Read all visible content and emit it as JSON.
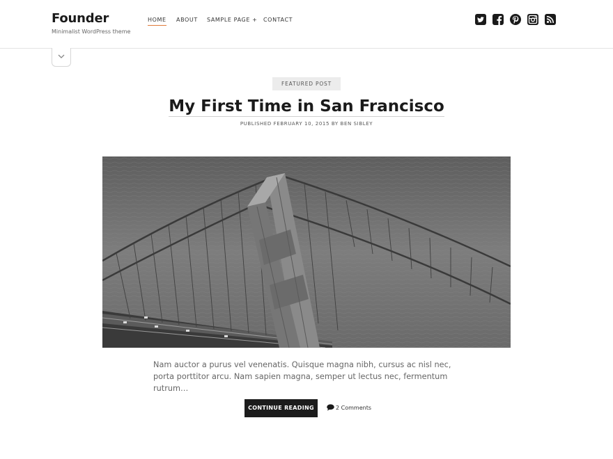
{
  "site": {
    "title": "Founder",
    "tagline": "Minimalist WordPress theme"
  },
  "nav": {
    "items": [
      "HOME",
      "ABOUT",
      "SAMPLE PAGE +",
      "CONTACT"
    ],
    "active": "HOME"
  },
  "social": {
    "icons": [
      "twitter-icon",
      "facebook-icon",
      "pinterest-icon",
      "instagram-icon",
      "rss-icon"
    ]
  },
  "post": {
    "badge": "FEATURED POST",
    "title": "My First Time in San Francisco",
    "meta": "PUBLISHED FEBRUARY 10, 2015 BY BEN SIBLEY",
    "excerpt": "Nam auctor a purus vel venenatis. Quisque magna nibh, cursus ac nisl nec, porta porttitor arcu. Nam sapien magna, semper ut lectus nec, fermentum rutrum…",
    "continue_label": "CONTINUE READING",
    "comments": "2 Comments"
  },
  "colors": {
    "accent": "#e07b39",
    "button_bg": "#1c1c1c",
    "text": "#1a1a1a"
  }
}
